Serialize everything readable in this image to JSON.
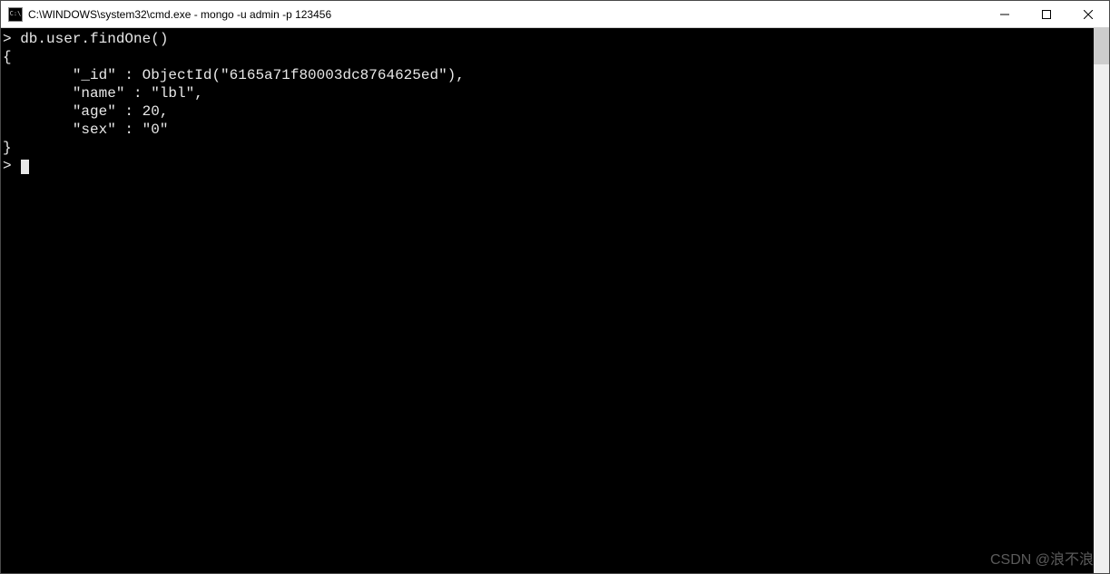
{
  "window": {
    "icon_label": "C:\\",
    "title": "C:\\WINDOWS\\system32\\cmd.exe - mongo  -u admin -p 123456"
  },
  "terminal": {
    "line_prompt1": "> ",
    "line_cmd": "db.user.findOne()",
    "line_brace_open": "{",
    "line_id": "        \"_id\" : ObjectId(\"6165a71f80003dc8764625ed\"),",
    "line_name": "        \"name\" : \"lbl\",",
    "line_age": "        \"age\" : 20,",
    "line_sex": "        \"sex\" : \"0\"",
    "line_brace_close": "}",
    "line_prompt2": "> "
  },
  "watermark": "CSDN @浪不浪"
}
